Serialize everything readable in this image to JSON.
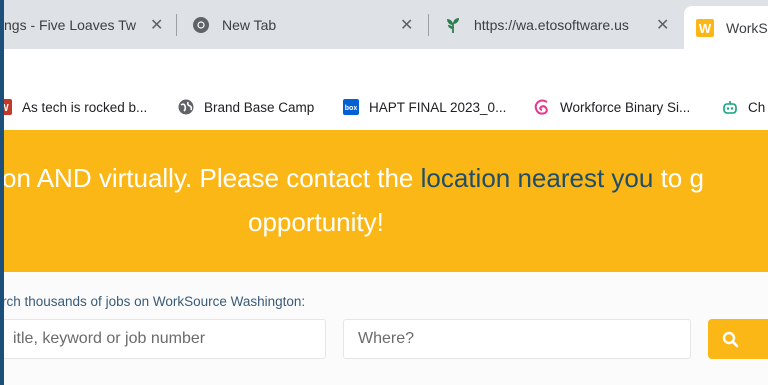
{
  "tabs": [
    {
      "title": "ngs - Five Loaves Two",
      "icon": "none"
    },
    {
      "title": "New Tab",
      "icon": "chrome-icon"
    },
    {
      "title": "https://wa.etosoftware.us",
      "icon": "sprout-icon"
    },
    {
      "title": "WorkS",
      "icon": "worksource-icon"
    }
  ],
  "tab_close_glyph": "✕",
  "bookmarks": [
    {
      "label": "As tech is rocked b...",
      "icon": "w-icon"
    },
    {
      "label": "Brand Base Camp",
      "icon": "globe-icon"
    },
    {
      "label": "HAPT FINAL 2023_0...",
      "icon": "box-icon"
    },
    {
      "label": "Workforce Binary Si...",
      "icon": "swirl-icon"
    },
    {
      "label": "Ch",
      "icon": "robot-icon"
    }
  ],
  "banner": {
    "line1_before": "on AND virtually. Please contact the ",
    "line1_link": "location nearest you",
    "line1_after": " to g",
    "line2": "opportunity!"
  },
  "search": {
    "label": "rch thousands of jobs on WorkSource Washington:",
    "keyword_placeholder": "itle, keyword or job number",
    "location_placeholder": "Where?",
    "button_icon": "search-icon"
  },
  "colors": {
    "accent": "#fbb715",
    "link": "#1f4e6b",
    "tabstrip": "#dee1e6"
  }
}
